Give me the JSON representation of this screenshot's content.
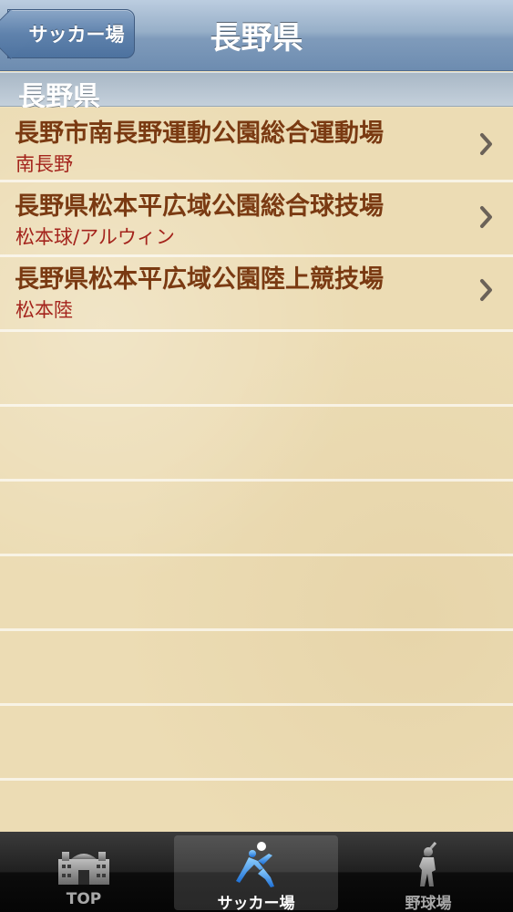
{
  "navbar": {
    "back_label": "サッカー場",
    "title": "長野県"
  },
  "section": {
    "title": "長野県"
  },
  "list": [
    {
      "title": "長野市南長野運動公園総合運動場",
      "subtitle": "南長野"
    },
    {
      "title": "長野県松本平広域公園総合球技場",
      "subtitle": "松本球/アルウィン"
    },
    {
      "title": "長野県松本平広域公園陸上競技場",
      "subtitle": "松本陸"
    }
  ],
  "tabbar": {
    "tabs": [
      {
        "label": "TOP",
        "icon": "stadium-icon",
        "selected": false
      },
      {
        "label": "サッカー場",
        "icon": "soccer-player-icon",
        "selected": true
      },
      {
        "label": "野球場",
        "icon": "baseball-player-icon",
        "selected": false
      }
    ]
  },
  "colors": {
    "row_title": "#7a3a12",
    "row_subtitle": "#a4241c",
    "tab_selected": "#3b8ff0"
  }
}
